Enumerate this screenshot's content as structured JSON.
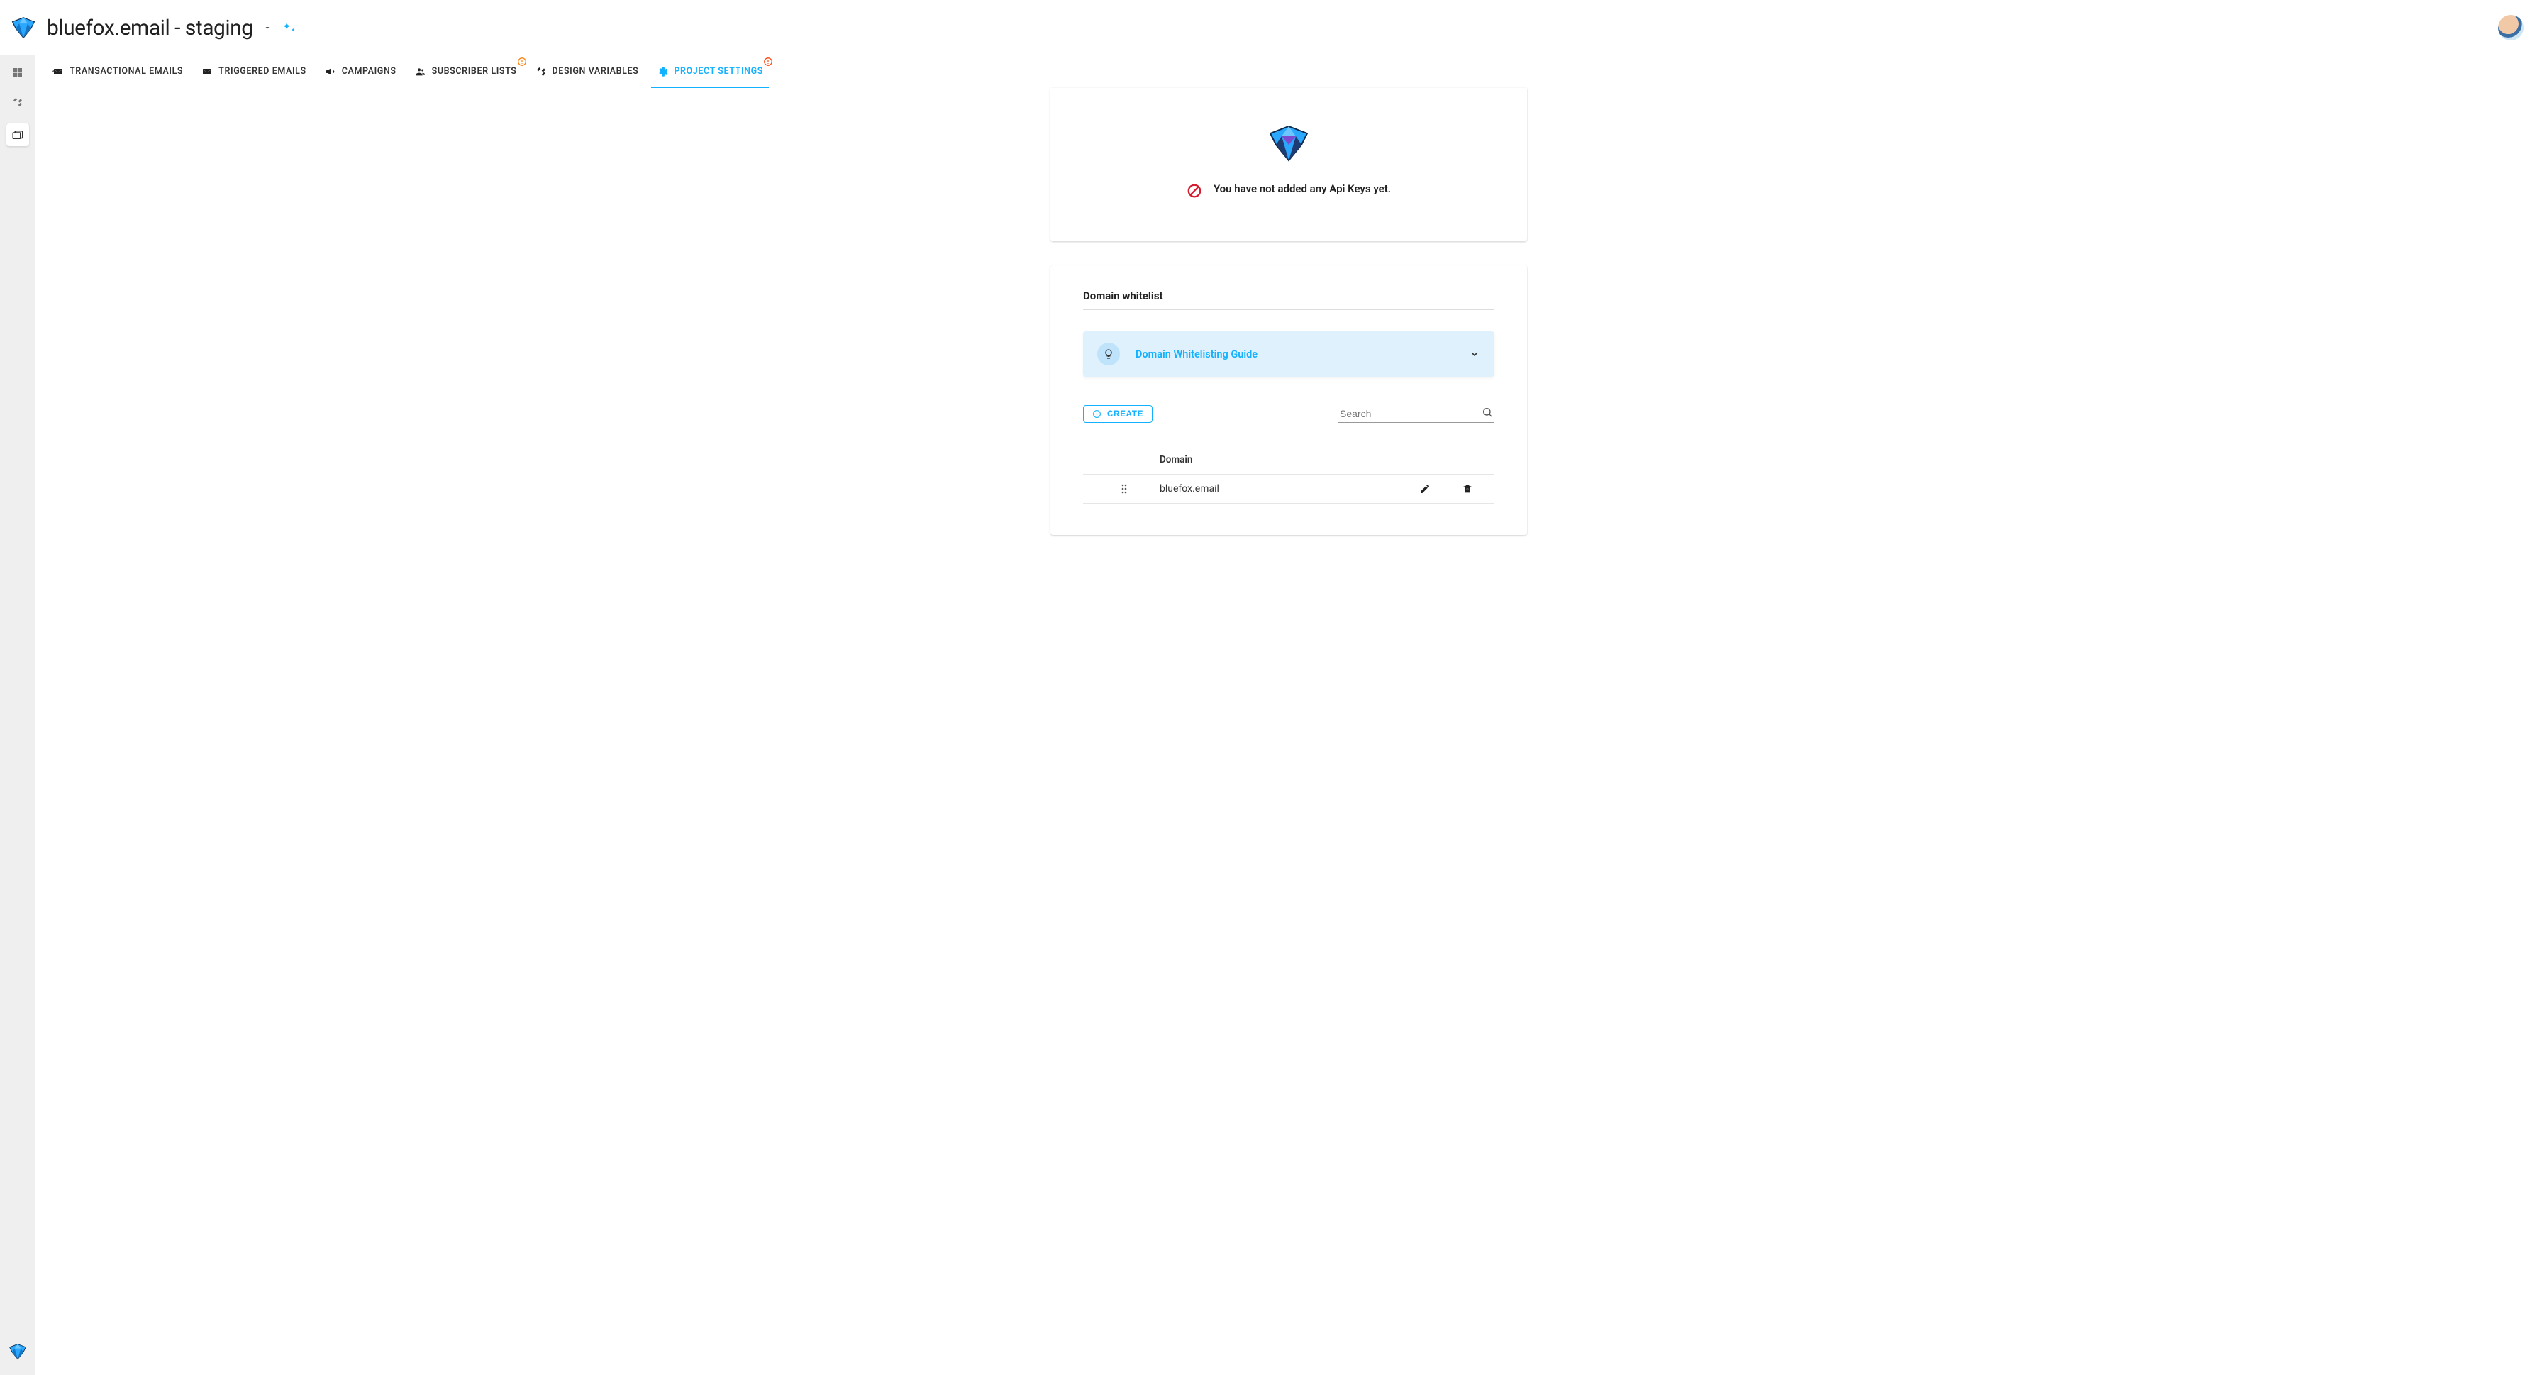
{
  "header": {
    "title": "bluefox.email - staging"
  },
  "tabs": [
    {
      "label": "TRANSACTIONAL EMAILS",
      "alert": false
    },
    {
      "label": "TRIGGERED EMAILS",
      "alert": false
    },
    {
      "label": "CAMPAIGNS",
      "alert": false,
      "arrow": true
    },
    {
      "label": "SUBSCRIBER LISTS",
      "alert": true
    },
    {
      "label": "DESIGN VARIABLES",
      "alert": false
    },
    {
      "label": "PROJECT SETTINGS",
      "alert": true,
      "active": true
    }
  ],
  "empty_state": {
    "message": "You have not added any Api Keys yet."
  },
  "domain_section": {
    "title": "Domain whitelist",
    "banner_link": "Domain Whitelisting Guide",
    "create_label": "CREATE",
    "search_placeholder": "Search",
    "column_header": "Domain",
    "rows": [
      {
        "domain": "bluefox.email"
      }
    ]
  }
}
